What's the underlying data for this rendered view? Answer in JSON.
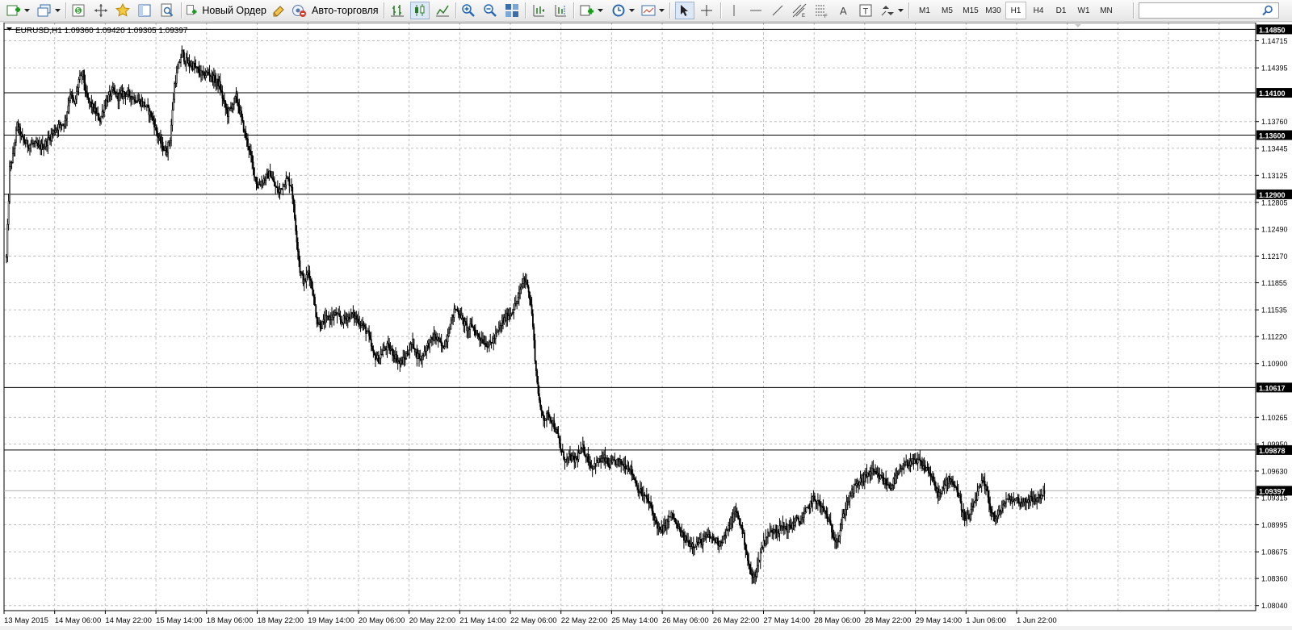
{
  "toolbar": {
    "new_order_label": "Новый Ордер",
    "auto_trading_label": "Авто-торговля",
    "timeframes": [
      "M1",
      "M5",
      "M15",
      "M30",
      "H1",
      "H4",
      "D1",
      "W1",
      "MN"
    ],
    "active_timeframe": "H1",
    "search_placeholder": ""
  },
  "chart": {
    "header_text": "EURUSD,H1  1.09360 1.09420 1.09305 1.09397",
    "price_ticks": [
      "1.14715",
      "1.14395",
      "1.13760",
      "1.13445",
      "1.13125",
      "1.12805",
      "1.12490",
      "1.12170",
      "1.11855",
      "1.11535",
      "1.11220",
      "1.10900",
      "1.10265",
      "1.09950",
      "1.09630",
      "1.09315",
      "1.08995",
      "1.08675",
      "1.08360",
      "1.08040"
    ],
    "horizontal_lines": [
      "1.14850",
      "1.14100",
      "1.13600",
      "1.12900",
      "1.10617",
      "1.09878"
    ],
    "current_price": "1.09397",
    "time_labels": [
      "13 May 2015",
      "14 May 06:00",
      "14 May 22:00",
      "15 May 14:00",
      "18 May 06:00",
      "18 May 22:00",
      "19 May 14:00",
      "20 May 06:00",
      "20 May 22:00",
      "21 May 14:00",
      "22 May 06:00",
      "22 May 22:00",
      "25 May 14:00",
      "26 May 06:00",
      "26 May 22:00",
      "27 May 14:00",
      "28 May 06:00",
      "28 May 22:00",
      "29 May 14:00",
      "1 Jun 06:00",
      "1 Jun 22:00"
    ]
  },
  "chart_data": {
    "type": "candlestick",
    "symbol": "EURUSD",
    "timeframe": "H1",
    "last_bar": {
      "open": 1.0936,
      "high": 1.0942,
      "low": 1.09305,
      "close": 1.09397
    },
    "ylim": [
      1.0798,
      1.1493
    ],
    "y_ticks": [
      1.14715,
      1.14395,
      1.1376,
      1.13445,
      1.13125,
      1.12805,
      1.1249,
      1.1217,
      1.11855,
      1.11535,
      1.1122,
      1.109,
      1.10265,
      1.0995,
      1.0963,
      1.09315,
      1.08995,
      1.08675,
      1.0836,
      1.0804
    ],
    "horizontal_levels": [
      1.1485,
      1.141,
      1.136,
      1.129,
      1.10617,
      1.09878
    ],
    "close_path": [
      [
        0,
        1.1215
      ],
      [
        3,
        1.132
      ],
      [
        6,
        1.1335
      ],
      [
        10,
        1.1372
      ],
      [
        15,
        1.1355
      ],
      [
        20,
        1.1348
      ],
      [
        25,
        1.135
      ],
      [
        30,
        1.1345
      ],
      [
        36,
        1.1348
      ],
      [
        40,
        1.1356
      ],
      [
        45,
        1.1366
      ],
      [
        50,
        1.1372
      ],
      [
        55,
        1.1375
      ],
      [
        60,
        1.141
      ],
      [
        64,
        1.1395
      ],
      [
        68,
        1.1425
      ],
      [
        72,
        1.1432
      ],
      [
        75,
        1.1405
      ],
      [
        80,
        1.1395
      ],
      [
        84,
        1.1386
      ],
      [
        88,
        1.1378
      ],
      [
        92,
        1.1395
      ],
      [
        96,
        1.1405
      ],
      [
        100,
        1.1412
      ],
      [
        105,
        1.1405
      ],
      [
        110,
        1.141
      ],
      [
        115,
        1.1408
      ],
      [
        120,
        1.1404
      ],
      [
        125,
        1.14
      ],
      [
        130,
        1.1396
      ],
      [
        134,
        1.1388
      ],
      [
        138,
        1.1378
      ],
      [
        142,
        1.136
      ],
      [
        146,
        1.1348
      ],
      [
        150,
        1.134
      ],
      [
        154,
        1.1356
      ],
      [
        158,
        1.142
      ],
      [
        162,
        1.1442
      ],
      [
        165,
        1.1458
      ],
      [
        168,
        1.1448
      ],
      [
        172,
        1.1444
      ],
      [
        176,
        1.1442
      ],
      [
        180,
        1.1436
      ],
      [
        185,
        1.143
      ],
      [
        190,
        1.1434
      ],
      [
        195,
        1.1426
      ],
      [
        200,
        1.142
      ],
      [
        204,
        1.14
      ],
      [
        208,
        1.1385
      ],
      [
        212,
        1.1395
      ],
      [
        216,
        1.1405
      ],
      [
        220,
        1.1385
      ],
      [
        224,
        1.1362
      ],
      [
        228,
        1.1345
      ],
      [
        232,
        1.132
      ],
      [
        236,
        1.13
      ],
      [
        240,
        1.1305
      ],
      [
        244,
        1.131
      ],
      [
        248,
        1.1315
      ],
      [
        252,
        1.13
      ],
      [
        256,
        1.1292
      ],
      [
        260,
        1.1302
      ],
      [
        264,
        1.1308
      ],
      [
        268,
        1.13
      ],
      [
        272,
        1.125
      ],
      [
        276,
        1.12
      ],
      [
        280,
        1.1185
      ],
      [
        284,
        1.12
      ],
      [
        288,
        1.1175
      ],
      [
        292,
        1.114
      ],
      [
        296,
        1.1135
      ],
      [
        300,
        1.1142
      ],
      [
        305,
        1.1145
      ],
      [
        310,
        1.1148
      ],
      [
        315,
        1.114
      ],
      [
        320,
        1.1145
      ],
      [
        325,
        1.1148
      ],
      [
        330,
        1.1142
      ],
      [
        335,
        1.1135
      ],
      [
        340,
        1.1125
      ],
      [
        345,
        1.11
      ],
      [
        350,
        1.1095
      ],
      [
        354,
        1.1105
      ],
      [
        358,
        1.111
      ],
      [
        362,
        1.1105
      ],
      [
        366,
        1.1098
      ],
      [
        370,
        1.109
      ],
      [
        374,
        1.1095
      ],
      [
        378,
        1.1105
      ],
      [
        382,
        1.1115
      ],
      [
        386,
        1.11
      ],
      [
        390,
        1.1096
      ],
      [
        394,
        1.1108
      ],
      [
        398,
        1.1115
      ],
      [
        402,
        1.1122
      ],
      [
        406,
        1.1118
      ],
      [
        410,
        1.1108
      ],
      [
        414,
        1.112
      ],
      [
        418,
        1.114
      ],
      [
        422,
        1.1155
      ],
      [
        426,
        1.115
      ],
      [
        430,
        1.1138
      ],
      [
        434,
        1.113
      ],
      [
        438,
        1.1135
      ],
      [
        442,
        1.1125
      ],
      [
        446,
        1.112
      ],
      [
        450,
        1.1115
      ],
      [
        454,
        1.1112
      ],
      [
        458,
        1.1118
      ],
      [
        462,
        1.1128
      ],
      [
        466,
        1.1138
      ],
      [
        470,
        1.1145
      ],
      [
        474,
        1.115
      ],
      [
        478,
        1.1158
      ],
      [
        482,
        1.117
      ],
      [
        486,
        1.119
      ],
      [
        490,
        1.1185
      ],
      [
        494,
        1.115
      ],
      [
        498,
        1.108
      ],
      [
        502,
        1.1035
      ],
      [
        506,
        1.1025
      ],
      [
        510,
        1.103
      ],
      [
        514,
        1.102
      ],
      [
        518,
        1.1005
      ],
      [
        522,
        1.0985
      ],
      [
        526,
        1.0975
      ],
      [
        530,
        1.098
      ],
      [
        534,
        1.0975
      ],
      [
        538,
        1.0982
      ],
      [
        542,
        1.099
      ],
      [
        546,
        1.098
      ],
      [
        550,
        1.0968
      ],
      [
        554,
        1.0972
      ],
      [
        558,
        1.0975
      ],
      [
        562,
        1.0978
      ],
      [
        566,
        1.097
      ],
      [
        570,
        1.0972
      ],
      [
        574,
        1.0975
      ],
      [
        578,
        1.0972
      ],
      [
        582,
        1.097
      ],
      [
        586,
        1.0968
      ],
      [
        590,
        1.0955
      ],
      [
        594,
        1.0942
      ],
      [
        598,
        1.0935
      ],
      [
        602,
        1.093
      ],
      [
        606,
        1.092
      ],
      [
        610,
        1.0905
      ],
      [
        614,
        1.0892
      ],
      [
        618,
        1.0895
      ],
      [
        622,
        1.0905
      ],
      [
        626,
        1.0912
      ],
      [
        630,
        1.0898
      ],
      [
        634,
        1.089
      ],
      [
        638,
        1.0882
      ],
      [
        642,
        1.0878
      ],
      [
        646,
        1.0876
      ],
      [
        650,
        1.0878
      ],
      [
        654,
        1.088
      ],
      [
        658,
        1.0885
      ],
      [
        662,
        1.0885
      ],
      [
        666,
        1.0882
      ],
      [
        670,
        1.0878
      ],
      [
        674,
        1.0884
      ],
      [
        678,
        1.0892
      ],
      [
        682,
        1.0905
      ],
      [
        686,
        1.0915
      ],
      [
        690,
        1.0902
      ],
      [
        694,
        1.088
      ],
      [
        698,
        1.085
      ],
      [
        702,
        1.0835
      ],
      [
        706,
        1.085
      ],
      [
        710,
        1.0872
      ],
      [
        714,
        1.0885
      ],
      [
        718,
        1.089
      ],
      [
        722,
        1.0895
      ],
      [
        726,
        1.0893
      ],
      [
        730,
        1.0898
      ],
      [
        734,
        1.0895
      ],
      [
        738,
        1.0898
      ],
      [
        742,
        1.0905
      ],
      [
        746,
        1.0903
      ],
      [
        750,
        1.091
      ],
      [
        754,
        1.092
      ],
      [
        758,
        1.093
      ],
      [
        762,
        1.0928
      ],
      [
        766,
        1.092
      ],
      [
        770,
        1.0915
      ],
      [
        774,
        1.09
      ],
      [
        778,
        1.0885
      ],
      [
        782,
        1.0882
      ],
      [
        786,
        1.0905
      ],
      [
        790,
        1.0925
      ],
      [
        794,
        1.0935
      ],
      [
        798,
        1.0945
      ],
      [
        802,
        1.095
      ],
      [
        806,
        1.0955
      ],
      [
        810,
        1.096
      ],
      [
        814,
        1.0962
      ],
      [
        818,
        1.0958
      ],
      [
        822,
        1.0955
      ],
      [
        826,
        1.095
      ],
      [
        830,
        1.0945
      ],
      [
        834,
        1.095
      ],
      [
        838,
        1.0958
      ],
      [
        842,
        1.0965
      ],
      [
        846,
        1.097
      ],
      [
        850,
        1.0975
      ],
      [
        854,
        1.0972
      ],
      [
        858,
        1.0975
      ],
      [
        862,
        1.0968
      ],
      [
        866,
        1.0966
      ],
      [
        870,
        1.0955
      ],
      [
        874,
        1.094
      ],
      [
        878,
        1.0935
      ],
      [
        882,
        1.0945
      ],
      [
        886,
        1.0955
      ],
      [
        890,
        1.095
      ],
      [
        894,
        1.094
      ],
      [
        898,
        1.092
      ],
      [
        902,
        1.0905
      ],
      [
        906,
        1.091
      ],
      [
        910,
        1.0925
      ],
      [
        914,
        1.094
      ],
      [
        918,
        1.095
      ],
      [
        922,
        1.0938
      ],
      [
        926,
        1.0915
      ],
      [
        930,
        1.0905
      ],
      [
        934,
        1.0915
      ],
      [
        938,
        1.0925
      ],
      [
        942,
        1.093
      ],
      [
        946,
        1.0928
      ],
      [
        950,
        1.093
      ],
      [
        954,
        1.0925
      ],
      [
        958,
        1.0928
      ],
      [
        962,
        1.093
      ],
      [
        966,
        1.0927
      ],
      [
        970,
        1.0932
      ],
      [
        974,
        1.0935
      ],
      [
        976,
        1.09397
      ]
    ]
  }
}
